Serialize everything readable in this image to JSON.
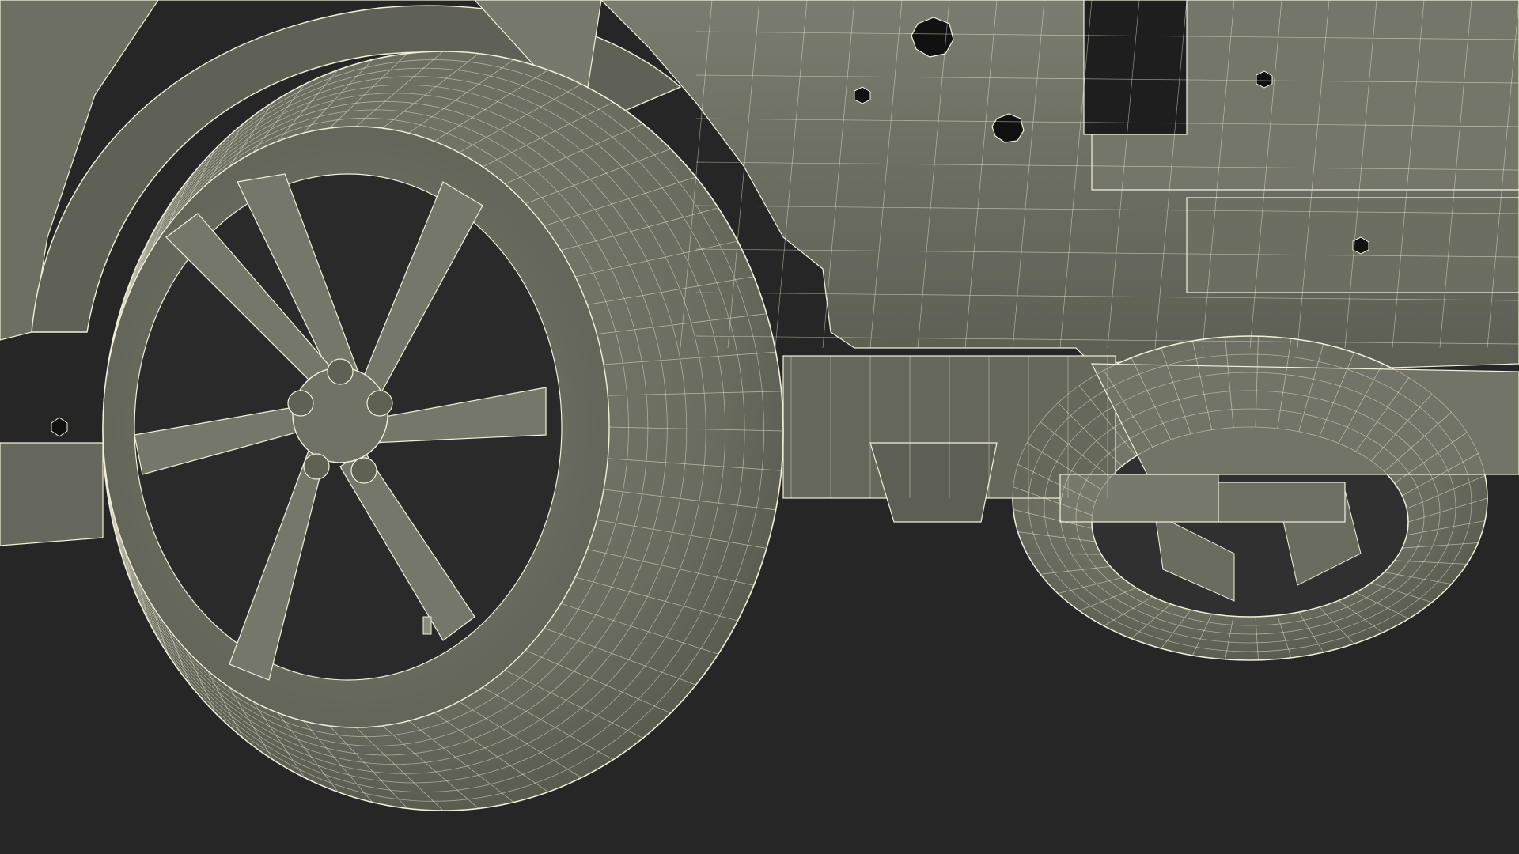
{
  "viewport": {
    "background_color": "#262626",
    "surface_color": "#6f7165",
    "surface_dark_color": "#4a4b42",
    "wire_color": "#f2f0d8",
    "hole_color": "#111111"
  },
  "scene": {
    "model_parts": [
      "front-wheel",
      "rear-wheel",
      "fender-arch",
      "chassis-frame",
      "wheel-hub",
      "lug-nuts",
      "suspension-mount",
      "rear-bumper"
    ]
  }
}
